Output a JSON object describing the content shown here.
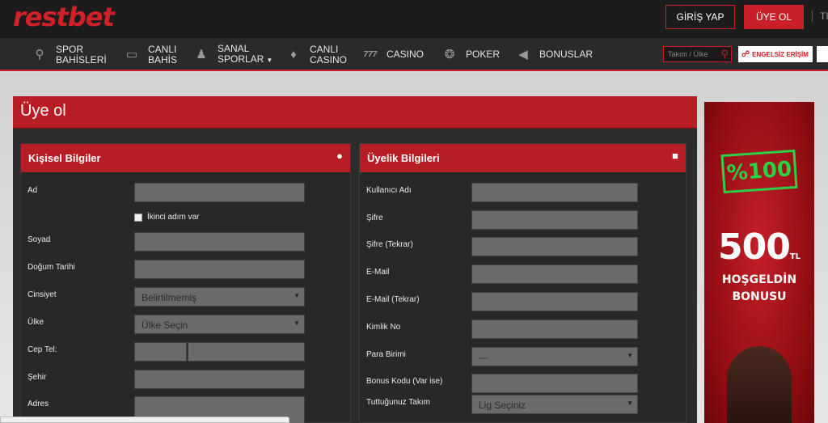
{
  "header": {
    "logo": {
      "part1": "rest",
      "part2": "bet"
    },
    "login_label": "GİRİŞ YAP",
    "register_label": "ÜYE OL",
    "lang_label": "TI"
  },
  "nav": {
    "items": [
      {
        "line1": "SPOR",
        "line2": "BAHİSLERİ",
        "icon": "whistle-icon"
      },
      {
        "line1": "CANLI",
        "line2": "BAHİS",
        "icon": "live-tv-icon"
      },
      {
        "line1": "SANAL",
        "line2": "SPORLAR",
        "icon": "virtual-sports-icon"
      },
      {
        "line1": "CANLI",
        "line2": "CASINO",
        "icon": "card-suits-icon"
      },
      {
        "line1": "CASINO",
        "line2": "",
        "icon": "slot-777-icon"
      },
      {
        "line1": "POKER",
        "line2": "",
        "icon": "poker-chip-icon"
      },
      {
        "line1": "BONUSLAR",
        "line2": "",
        "icon": "megaphone-icon"
      }
    ],
    "search_placeholder": "Takım / Ülke",
    "unblock_label": "ENGELSİZ ERİŞİM"
  },
  "page": {
    "title": "Üye ol"
  },
  "personal": {
    "title": "Kişisel Bilgiler",
    "icon": "user-icon",
    "fields": {
      "name": "Ad",
      "second_step": "İkinci adım var",
      "surname": "Soyad",
      "birthdate": "Doğum Tarihi",
      "gender": "Cinsiyet",
      "gender_value": "Belirtilmemiş",
      "country": "Ülke",
      "country_value": "Ülke Seçin",
      "phone": "Cep Tel:",
      "city": "Şehir",
      "address": "Adres"
    }
  },
  "membership": {
    "title": "Üyelik Bilgileri",
    "icon": "lock-icon",
    "fields": {
      "username": "Kullanıcı Adı",
      "password": "Şifre",
      "password_repeat": "Şifre (Tekrar)",
      "email": "E-Mail",
      "email_repeat": "E-Mail (Tekrar)",
      "id_no": "Kimlik No",
      "currency": "Para Birimi",
      "currency_value": "---",
      "bonus_code": "Bonus Kodu (Var ise)",
      "team": "Tuttuğunuz Takım",
      "team_value": "Lig Seçiniz"
    }
  },
  "banner": {
    "stamp": "%100",
    "amount": "500",
    "currency": "TL",
    "line1": "HOŞGELDİN",
    "line2": "BONUSU"
  },
  "colors": {
    "brand_red": "#c91f28",
    "nav_bg": "#2a2a2a",
    "stamp_green": "#2bd244"
  }
}
